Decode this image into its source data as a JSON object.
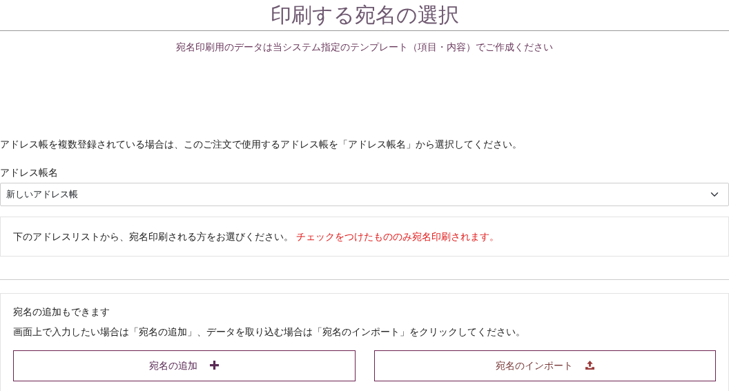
{
  "title": "印刷する宛名の選択",
  "subtitle": "宛名印刷用のデータは当システム指定のテンプレート（項目・内容）でご作成ください",
  "instruction": "アドレス帳を複数登録されている場合は、このご注文で使用するアドレス帳を「アドレス帳名」から選択してください。",
  "address_book": {
    "label": "アドレス帳名",
    "value": "新しいアドレス帳"
  },
  "notice": {
    "text": "下のアドレスリストから、宛名印刷される方をお選びください。",
    "warning": "チェックをつけたもののみ宛名印刷されます。"
  },
  "add_panel": {
    "heading": "宛名の追加もできます",
    "text": "画面上で入力したい場合は「宛名の追加」、データを取り込む場合は「宛名のインポート」をクリックしてください。",
    "buttons": [
      {
        "label": "宛名の追加",
        "kind": "add"
      },
      {
        "label": "宛名のインポート",
        "kind": "import"
      }
    ]
  }
}
